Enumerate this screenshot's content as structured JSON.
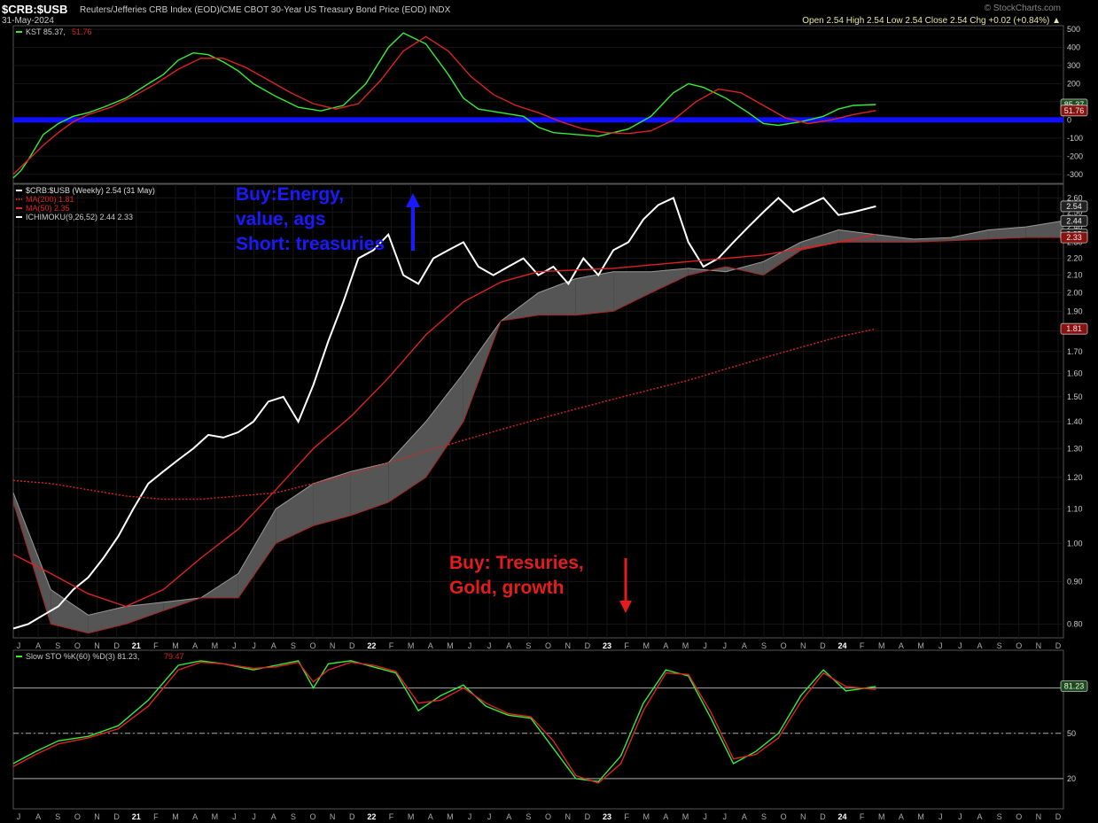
{
  "header": {
    "symbol": "$CRB:$USB",
    "description": "Reuters/Jefferies CRB Index (EOD)/CME CBOT 30-Year US Treasury Bond Price (EOD)  INDX",
    "date": "31-May-2024",
    "brand": "© StockCharts.com",
    "ohlc": "Open 2.54  High 2.54  Low 2.54  Close 2.54  Chg +0.02 (+0.84%) ▲"
  },
  "annotations": {
    "buy_energy": [
      "Buy:Energy,",
      "value, ags",
      "Short: treasuries"
    ],
    "buy_treasuries": [
      "Buy: Tresuries,",
      "Gold, growth"
    ]
  },
  "colors": {
    "background": "#000000",
    "price": "#ffffff",
    "kst": "#33ee33",
    "signal": "#dd2222",
    "zero_line": "#1010ff",
    "cloud_bull": "#555555",
    "cloud_bear": "#5a0a0a",
    "annotation_blue": "#1a1aff",
    "annotation_red": "#e51c1c"
  },
  "chart_data": [
    {
      "type": "line",
      "panel": "kst",
      "legend": [
        {
          "label": "KST 85.37,",
          "color": "#33ee33"
        },
        {
          "label": "51.76",
          "color": "#dd2222"
        }
      ],
      "ylim": [
        -350,
        520
      ],
      "yticks": [
        500,
        400,
        300,
        200,
        100,
        0,
        -100,
        -200,
        -300
      ],
      "value_tags": [
        {
          "text": "85.37",
          "value": 85.37
        },
        {
          "text": "51.76",
          "value": 51.76
        }
      ],
      "reference_line": 0,
      "series": [
        {
          "name": "KST",
          "color": "#33ee33",
          "x": [
            0,
            0.1,
            0.2,
            0.3,
            0.4,
            0.6,
            0.8,
            1.0,
            1.2,
            1.5,
            1.8,
            2.0,
            2.2,
            2.4,
            2.6,
            2.8,
            3.0,
            3.2,
            3.5,
            3.8,
            4.1,
            4.4,
            4.7,
            5.0,
            5.2,
            5.5,
            5.8,
            6.0,
            6.2,
            6.5,
            6.8,
            7.0,
            7.2,
            7.5,
            7.8,
            8.0,
            8.2,
            8.5,
            8.8,
            9.0,
            9.2,
            9.5,
            9.8,
            10.0,
            10.2,
            10.5,
            10.8,
            11.0,
            11.2,
            11.5
          ],
          "values": [
            -320,
            -280,
            -220,
            -150,
            -80,
            -20,
            20,
            40,
            70,
            120,
            200,
            250,
            330,
            370,
            360,
            320,
            270,
            200,
            130,
            70,
            50,
            80,
            200,
            400,
            480,
            420,
            250,
            120,
            60,
            40,
            20,
            -40,
            -70,
            -80,
            -90,
            -70,
            -50,
            20,
            150,
            200,
            180,
            120,
            40,
            -20,
            -30,
            -10,
            20,
            60,
            80,
            85
          ]
        },
        {
          "name": "Signal",
          "color": "#dd2222",
          "x": [
            0,
            0.2,
            0.4,
            0.6,
            0.8,
            1.0,
            1.3,
            1.6,
            1.9,
            2.2,
            2.5,
            2.8,
            3.1,
            3.4,
            3.7,
            4.0,
            4.3,
            4.6,
            4.9,
            5.2,
            5.5,
            5.8,
            6.1,
            6.4,
            6.7,
            7.0,
            7.3,
            7.6,
            7.9,
            8.2,
            8.5,
            8.8,
            9.1,
            9.4,
            9.7,
            10.0,
            10.3,
            10.6,
            10.9,
            11.2,
            11.5
          ],
          "values": [
            -300,
            -220,
            -140,
            -70,
            -10,
            30,
            70,
            130,
            200,
            280,
            340,
            340,
            290,
            220,
            150,
            90,
            60,
            90,
            220,
            380,
            460,
            380,
            240,
            140,
            80,
            40,
            -10,
            -50,
            -70,
            -75,
            -60,
            0,
            100,
            170,
            150,
            80,
            10,
            -20,
            0,
            30,
            52
          ]
        }
      ]
    },
    {
      "type": "line",
      "panel": "price",
      "legend": [
        {
          "label": "$CRB:$USB (Weekly) 2.54 (31 May)",
          "color": "#ffffff"
        },
        {
          "label": "MA(200) 1.81",
          "color": "#dd2222"
        },
        {
          "label": "MA(50) 2.35",
          "color": "#dd2222"
        },
        {
          "label": "ICHIMOKU(9,26,52) 2.44 2.33",
          "color": "#ffffff"
        }
      ],
      "scale": "log",
      "ylim": [
        0.77,
        2.7
      ],
      "yticks": [
        "0.80",
        "0.90",
        "1.00",
        "1.10",
        "1.20",
        "1.30",
        "1.40",
        "1.50",
        "1.60",
        "1.70",
        "1.80",
        "1.90",
        "2.00",
        "2.10",
        "2.20",
        "2.30",
        "2.40",
        "2.50",
        "2.60"
      ],
      "value_tags": [
        {
          "text": "2.54",
          "value": 2.54
        },
        {
          "text": "2.44",
          "value": 2.44
        },
        {
          "text": "2.35",
          "value": 2.35
        },
        {
          "text": "2.33",
          "value": 2.33
        },
        {
          "text": "1.81",
          "value": 1.81
        }
      ],
      "series": [
        {
          "name": "$CRB:$USB",
          "color": "#ffffff",
          "x": [
            0,
            0.2,
            0.4,
            0.6,
            0.8,
            1.0,
            1.2,
            1.4,
            1.6,
            1.8,
            2.0,
            2.2,
            2.4,
            2.6,
            2.8,
            3.0,
            3.2,
            3.4,
            3.6,
            3.8,
            4.0,
            4.2,
            4.4,
            4.6,
            4.8,
            5.0,
            5.2,
            5.4,
            5.6,
            5.8,
            6.0,
            6.2,
            6.4,
            6.6,
            6.8,
            7.0,
            7.2,
            7.4,
            7.6,
            7.8,
            8.0,
            8.2,
            8.4,
            8.6,
            8.8,
            9.0,
            9.2,
            9.4,
            9.6,
            9.8,
            10.0,
            10.2,
            10.4,
            10.6,
            10.8,
            11.0,
            11.2,
            11.5
          ],
          "values": [
            0.79,
            0.8,
            0.82,
            0.84,
            0.88,
            0.91,
            0.96,
            1.02,
            1.1,
            1.18,
            1.22,
            1.26,
            1.3,
            1.35,
            1.34,
            1.36,
            1.4,
            1.48,
            1.5,
            1.4,
            1.55,
            1.75,
            1.95,
            2.2,
            2.25,
            2.35,
            2.1,
            2.05,
            2.2,
            2.25,
            2.3,
            2.15,
            2.1,
            2.15,
            2.2,
            2.1,
            2.15,
            2.05,
            2.2,
            2.1,
            2.25,
            2.3,
            2.45,
            2.55,
            2.6,
            2.3,
            2.15,
            2.2,
            2.3,
            2.4,
            2.5,
            2.6,
            2.5,
            2.55,
            2.6,
            2.48,
            2.5,
            2.54
          ]
        },
        {
          "name": "MA(50)",
          "color": "#dd2222",
          "x": [
            0,
            0.5,
            1.0,
            1.5,
            2.0,
            2.5,
            3.0,
            3.5,
            4.0,
            4.5,
            5.0,
            5.5,
            6.0,
            6.5,
            7.0,
            7.5,
            8.0,
            8.5,
            9.0,
            9.5,
            10.0,
            10.5,
            11.0,
            11.5
          ],
          "values": [
            0.97,
            0.92,
            0.87,
            0.84,
            0.88,
            0.96,
            1.04,
            1.16,
            1.3,
            1.42,
            1.58,
            1.78,
            1.95,
            2.06,
            2.12,
            2.13,
            2.14,
            2.16,
            2.18,
            2.2,
            2.22,
            2.26,
            2.3,
            2.35
          ]
        },
        {
          "name": "MA(200)",
          "color": "#dd2222",
          "x": [
            0,
            0.5,
            1.0,
            1.5,
            2.0,
            2.5,
            3.0,
            3.5,
            4.0,
            4.5,
            5.0,
            5.5,
            6.0,
            6.5,
            7.0,
            7.5,
            8.0,
            8.5,
            9.0,
            9.5,
            10.0,
            10.5,
            11.0,
            11.5
          ],
          "values": [
            1.19,
            1.18,
            1.16,
            1.14,
            1.13,
            1.13,
            1.14,
            1.15,
            1.18,
            1.21,
            1.25,
            1.29,
            1.33,
            1.37,
            1.41,
            1.45,
            1.49,
            1.53,
            1.57,
            1.62,
            1.67,
            1.72,
            1.77,
            1.81
          ]
        },
        {
          "name": "Cloud A",
          "color": "#888888",
          "x": [
            0,
            0.5,
            1.0,
            1.5,
            2.0,
            2.5,
            3.0,
            3.5,
            4.0,
            4.5,
            5.0,
            5.5,
            6.0,
            6.5,
            7.0,
            7.5,
            8.0,
            8.5,
            9.0,
            9.5,
            10.0,
            10.5,
            11.0,
            11.5,
            12.0,
            12.5,
            13.0,
            13.5,
            14.0
          ],
          "values": [
            1.15,
            0.88,
            0.82,
            0.84,
            0.85,
            0.86,
            0.92,
            1.1,
            1.18,
            1.22,
            1.25,
            1.4,
            1.6,
            1.85,
            2.0,
            2.08,
            2.12,
            2.12,
            2.14,
            2.12,
            2.18,
            2.3,
            2.38,
            2.35,
            2.32,
            2.33,
            2.38,
            2.4,
            2.44
          ]
        },
        {
          "name": "Cloud B",
          "color": "#aa2222",
          "x": [
            0,
            0.5,
            1.0,
            1.5,
            2.0,
            2.5,
            3.0,
            3.5,
            4.0,
            4.5,
            5.0,
            5.5,
            6.0,
            6.5,
            7.0,
            7.5,
            8.0,
            8.5,
            9.0,
            9.5,
            10.0,
            10.5,
            11.0,
            11.5,
            12.0,
            12.5,
            13.0,
            13.5,
            14.0
          ],
          "values": [
            1.12,
            0.8,
            0.78,
            0.8,
            0.83,
            0.86,
            0.86,
            1.0,
            1.05,
            1.08,
            1.12,
            1.2,
            1.4,
            1.85,
            1.88,
            1.88,
            1.9,
            2.0,
            2.1,
            2.15,
            2.1,
            2.25,
            2.3,
            2.3,
            2.3,
            2.31,
            2.32,
            2.33,
            2.33
          ]
        }
      ]
    },
    {
      "type": "line",
      "panel": "stochastic",
      "legend": [
        {
          "label": "Slow STO %K(60) %D(3) 81.23,",
          "color": "#33ee33"
        },
        {
          "label": "79.47",
          "color": "#dd2222"
        }
      ],
      "ylim": [
        0,
        105
      ],
      "yticks": [
        20,
        50
      ],
      "value_tags": [
        {
          "text": "81.23",
          "value": 81.23
        }
      ],
      "reference_lines": [
        20,
        50,
        80
      ],
      "series": [
        {
          "name": "%K",
          "color": "#33ee33",
          "x": [
            0,
            0.3,
            0.6,
            1.0,
            1.4,
            1.8,
            2.2,
            2.5,
            2.8,
            3.2,
            3.5,
            3.8,
            4.0,
            4.2,
            4.5,
            4.8,
            5.1,
            5.4,
            5.7,
            6.0,
            6.3,
            6.6,
            6.9,
            7.2,
            7.5,
            7.8,
            8.1,
            8.4,
            8.7,
            9.0,
            9.3,
            9.6,
            9.9,
            10.2,
            10.5,
            10.8,
            11.1,
            11.5
          ],
          "values": [
            30,
            38,
            45,
            48,
            55,
            72,
            95,
            98,
            96,
            92,
            95,
            98,
            80,
            96,
            98,
            94,
            90,
            65,
            75,
            82,
            68,
            62,
            60,
            40,
            20,
            18,
            35,
            70,
            92,
            88,
            60,
            30,
            38,
            50,
            75,
            92,
            78,
            81
          ]
        },
        {
          "name": "%D",
          "color": "#dd2222",
          "x": [
            0,
            0.3,
            0.6,
            1.0,
            1.4,
            1.8,
            2.2,
            2.5,
            2.8,
            3.2,
            3.5,
            3.8,
            4.0,
            4.2,
            4.5,
            4.8,
            5.1,
            5.4,
            5.7,
            6.0,
            6.3,
            6.6,
            6.9,
            7.2,
            7.5,
            7.8,
            8.1,
            8.4,
            8.7,
            9.0,
            9.3,
            9.6,
            9.9,
            10.2,
            10.5,
            10.8,
            11.1,
            11.5
          ],
          "values": [
            28,
            36,
            43,
            47,
            53,
            68,
            92,
            97,
            96,
            93,
            94,
            97,
            84,
            92,
            97,
            95,
            91,
            70,
            72,
            80,
            70,
            63,
            61,
            45,
            22,
            17,
            30,
            65,
            90,
            89,
            64,
            33,
            36,
            47,
            71,
            90,
            81,
            79
          ]
        }
      ]
    }
  ],
  "x_axis_months": [
    "J",
    "A",
    "S",
    "O",
    "N",
    "D",
    "21",
    "F",
    "M",
    "A",
    "M",
    "J",
    "J",
    "A",
    "S",
    "O",
    "N",
    "D",
    "22",
    "F",
    "M",
    "A",
    "M",
    "J",
    "J",
    "A",
    "S",
    "O",
    "N",
    "D",
    "23",
    "F",
    "M",
    "A",
    "M",
    "J",
    "J",
    "A",
    "S",
    "O",
    "N",
    "D",
    "24",
    "F",
    "M",
    "A",
    "M",
    "J",
    "J",
    "A",
    "S",
    "O",
    "N",
    "D"
  ]
}
